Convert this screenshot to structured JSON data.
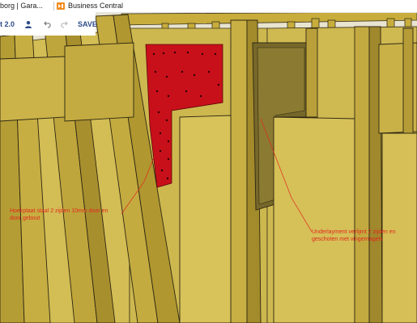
{
  "browser": {
    "tabs": [
      {
        "label": "borg | Gara..."
      },
      {
        "label": "Business Central"
      }
    ]
  },
  "toolbar": {
    "app_name": "t 2.0",
    "user_icon": "user-icon",
    "undo_icon": "undo-icon",
    "redo_icon": "redo-icon",
    "save_label": "SAVE"
  },
  "annotations": {
    "steel_plate": [
      "Hoekplaat staal 2 zijden 10mm door en",
      "door gebout"
    ],
    "underlayment": [
      "Underlayment verlijmt 2 zijden en",
      "geschoten met vingernagels"
    ]
  },
  "colors": {
    "steel_plate": "#c8101a",
    "timber": "#c9b245",
    "insulation": "#d6c057",
    "annotation_text": "#e0281c",
    "toolbar_text": "#2d4b8a"
  }
}
